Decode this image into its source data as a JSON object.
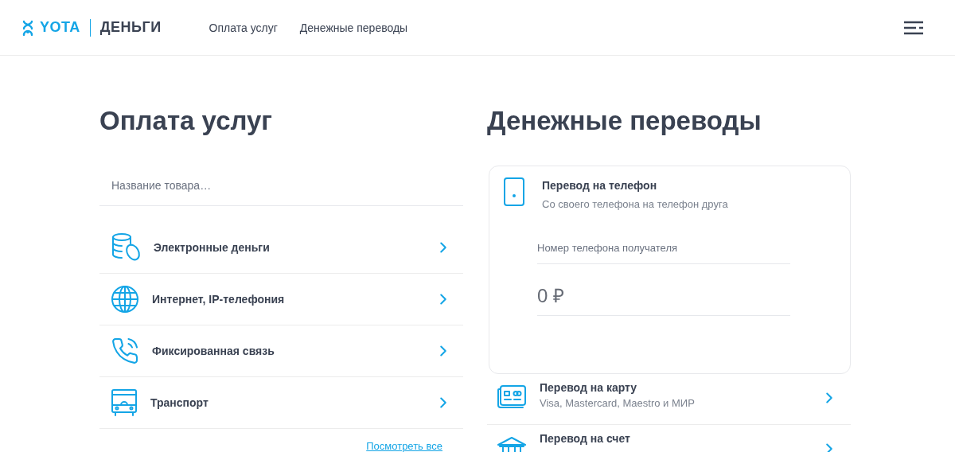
{
  "header": {
    "logo": {
      "brand": "YOTA",
      "product": "ДЕНЬГИ"
    },
    "nav": [
      {
        "label": "Оплата услуг"
      },
      {
        "label": "Денежные переводы"
      }
    ]
  },
  "services": {
    "title": "Оплата услуг",
    "search": {
      "placeholder": "Название товара…"
    },
    "items": [
      {
        "label": "Электронные деньги",
        "kind": "coins"
      },
      {
        "label": "Интернет, IP-телефония",
        "kind": "globe"
      },
      {
        "label": "Фиксированная связь",
        "kind": "phone"
      },
      {
        "label": "Транспорт",
        "kind": "bus"
      }
    ],
    "view_all": "Посмотреть все"
  },
  "transfers": {
    "title": "Денежные переводы",
    "phone_card": {
      "title": "Перевод на телефон",
      "subtitle": "Со своего телефона на телефон друга",
      "phone_field": {
        "placeholder": "Номер телефона получателя"
      },
      "amount_field": {
        "value": "0 ₽"
      }
    },
    "items": [
      {
        "title": "Перевод на карту",
        "subtitle": "Visa, Mastercard, Maestro и МИР",
        "kind": "card"
      },
      {
        "title": "Перевод на счет",
        "kind": "bank"
      }
    ]
  }
}
